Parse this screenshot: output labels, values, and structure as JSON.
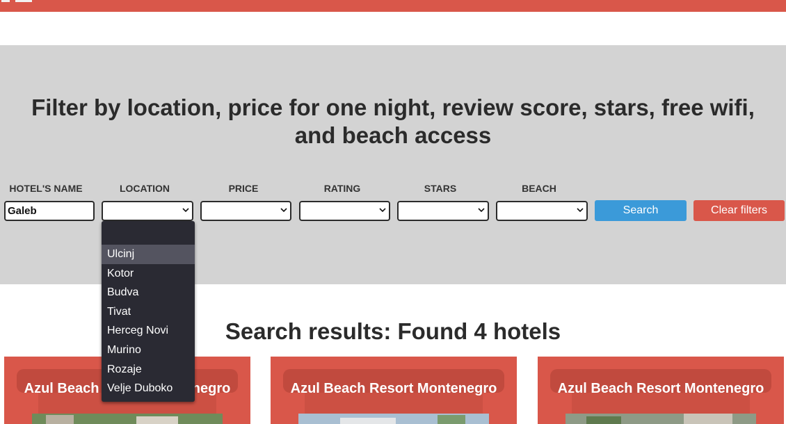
{
  "filters": {
    "title": "Filter by location, price for one night, review score, stars, free wifi, and beach access",
    "labels": {
      "name": "HOTEL'S NAME",
      "location": "LOCATION",
      "price": "PRICE",
      "rating": "RATING",
      "stars": "STARS",
      "beach": "BEACH"
    },
    "name_value": "Galeb",
    "search_label": "Search",
    "clear_label": "Clear filters"
  },
  "location_dropdown": {
    "options": [
      "Ulcinj",
      "Kotor",
      "Budva",
      "Tivat",
      "Herceg Novi",
      "Murino",
      "Rozaje",
      "Velje Duboko"
    ],
    "highlighted": "Ulcinj"
  },
  "results": {
    "title": "Search results: Found 4 hotels",
    "cards": [
      {
        "name": "Azul Beach Resort Montenegro"
      },
      {
        "name": "Azul Beach Resort Montenegro"
      },
      {
        "name": "Azul Beach Resort Montenegro"
      }
    ]
  },
  "colors": {
    "brand_red": "#d9574a",
    "search_blue": "#3b9ad9",
    "filter_bg": "#d3d3d3",
    "dropdown_bg": "#2a2a33"
  }
}
